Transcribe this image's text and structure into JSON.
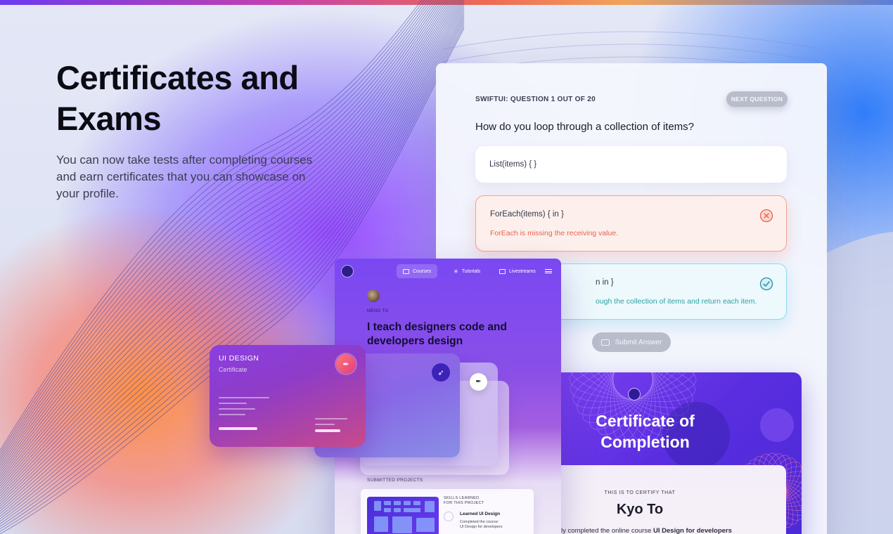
{
  "hero": {
    "title": "Certificates and Exams",
    "description": "You can now take tests after completing courses and earn certificates that you can showcase on your profile."
  },
  "exam": {
    "header": "SWIFTUI: QUESTION 1 OUT OF 20",
    "next_label": "NEXT QUESTION",
    "question": "How do you loop through a collection of items?",
    "options": [
      {
        "code": "List(items) { }",
        "hint": "",
        "state": "neutral"
      },
      {
        "code": "ForEach(items) { in }",
        "hint": "ForEach is missing the receiving value.",
        "state": "wrong"
      },
      {
        "code": "n in }",
        "hint": "ough the collection of items and return each item.",
        "state": "correct"
      }
    ],
    "submit_label": "Submit Answer"
  },
  "certificate": {
    "title": "Certificate of Completion",
    "certify_line": "THIS IS TO CERTIFY THAT",
    "name": "Kyo To",
    "statement_prefix": "fully completed the online course ",
    "course": "UI Design for developers"
  },
  "profile": {
    "nav": [
      "Courses",
      "Tutorials",
      "Livestreams"
    ],
    "author": "MENG TO",
    "headline": "I teach designers code and developers design",
    "submitted_label": "SUBMITTED PROJECTS",
    "skills_heading_1": "SKILLS LEARNED",
    "skills_heading_2": "FOR THIS PROJECT",
    "skill_name": "Learned UI Design",
    "skill_desc_1": "Completed the course:",
    "skill_desc_2": "UI Design for developers"
  },
  "ui_card": {
    "title": "UI DESIGN",
    "subtitle": "Certificate"
  },
  "colors": {
    "wrong": "#e8624f",
    "correct": "#2aa3a0",
    "accent_purple": "#5a2ee0"
  },
  "icons": [
    "x-circle-icon",
    "check-circle-icon",
    "swift-icon",
    "pen-tool-icon",
    "menu-icon"
  ]
}
